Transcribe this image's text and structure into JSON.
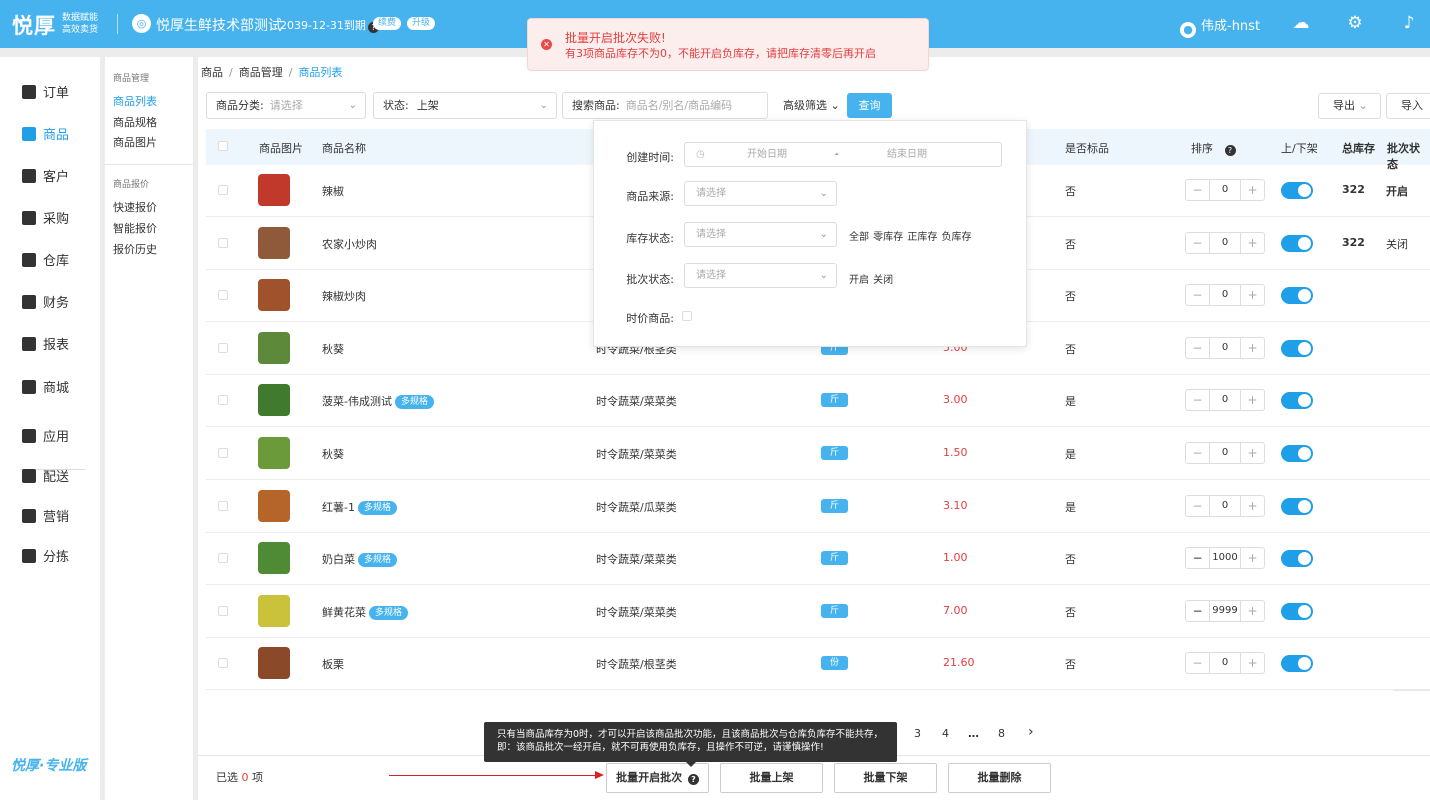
{
  "topbar": {
    "logo": "悦厚",
    "logo_sub1": "数据赋能",
    "logo_sub2": "高效卖货",
    "company": "悦厚生鲜技术部测试",
    "expiry": "2039-12-31到期",
    "renew": "续费",
    "upgrade": "升级",
    "user": "伟成-hnst",
    "icons": [
      "help-icon",
      "gear-icon",
      "bell-icon"
    ]
  },
  "toast": {
    "title": "批量开启批次失败!",
    "message": "有3项商品库存不为0，不能开启负库存，请把库存清零后再开启",
    "color": "#e23e3e"
  },
  "sidebar": {
    "items": [
      "订单",
      "商品",
      "客户",
      "采购",
      "仓库",
      "财务",
      "报表",
      "商城",
      "应用",
      "配送",
      "营销",
      "分拣"
    ],
    "active": "商品",
    "brand": "悦厚·专业版"
  },
  "subnav": {
    "group1": "商品管理",
    "group1_items": [
      "商品列表",
      "商品规格",
      "商品图片"
    ],
    "group2": "商品报价",
    "group2_items": [
      "快速报价",
      "智能报价",
      "报价历史"
    ]
  },
  "breadcrumb": [
    "商品",
    "商品管理",
    "商品列表"
  ],
  "filters": {
    "category_label": "商品分类:",
    "category_placeholder": "请选择",
    "status_label": "状态:",
    "status_value": "上架",
    "search_label": "搜索商品:",
    "search_placeholder": "商品名/别名/商品编码",
    "advanced": "高级筛选",
    "query": "查询",
    "export": "导出",
    "import": "导入"
  },
  "advanced_panel": {
    "created_label": "创建时间:",
    "start_placeholder": "开始日期",
    "dash": "-",
    "end_placeholder": "结束日期",
    "source_label": "商品来源:",
    "source_placeholder": "请选择",
    "stock_label": "库存状态:",
    "stock_placeholder": "请选择",
    "stock_options": "全部 零库存 正库存 负库存",
    "batch_label": "批次状态:",
    "batch_placeholder": "请选择",
    "batch_options": "开启 关闭",
    "seasonal_label": "时价商品:"
  },
  "table": {
    "headers": {
      "image": "商品图片",
      "name": "商品名称",
      "standard": "是否标品",
      "sort": "排序",
      "shelf": "上/下架",
      "stock": "总库存",
      "batch": "批次状态"
    },
    "rows": [
      {
        "name": "辣椒",
        "category": "",
        "unit": "",
        "price": "",
        "standard": "否",
        "sort": "0",
        "stock": "322",
        "batch": "开启",
        "multi": ""
      },
      {
        "name": "农家小炒肉",
        "category": "",
        "unit": "",
        "price": "",
        "standard": "否",
        "sort": "0",
        "stock": "322",
        "batch": "关闭",
        "multi": ""
      },
      {
        "name": "辣椒炒肉",
        "category": "",
        "unit": "",
        "price": "",
        "standard": "否",
        "sort": "0",
        "stock": "",
        "batch": "",
        "multi": ""
      },
      {
        "name": "秋葵",
        "category": "时令蔬菜/根茎类",
        "unit": "斤",
        "price": "5.00",
        "standard": "否",
        "sort": "0",
        "stock": "",
        "batch": "",
        "multi": ""
      },
      {
        "name": "菠菜-伟成测试",
        "category": "时令蔬菜/菜菜类",
        "unit": "斤",
        "price": "3.00",
        "standard": "是",
        "sort": "0",
        "stock": "",
        "batch": "",
        "multi": "多规格"
      },
      {
        "name": "秋葵",
        "category": "时令蔬菜/菜菜类",
        "unit": "斤",
        "price": "1.50",
        "standard": "是",
        "sort": "0",
        "stock": "",
        "batch": "",
        "multi": ""
      },
      {
        "name": "红薯-1",
        "category": "时令蔬菜/瓜菜类",
        "unit": "斤",
        "price": "3.10",
        "standard": "是",
        "sort": "0",
        "stock": "",
        "batch": "",
        "multi": "多规格"
      },
      {
        "name": "奶白菜",
        "category": "时令蔬菜/菜菜类",
        "unit": "斤",
        "price": "1.00",
        "standard": "否",
        "sort": "1000",
        "stock": "",
        "batch": "",
        "multi": "多规格"
      },
      {
        "name": "鲜黄花菜",
        "category": "时令蔬菜/菜菜类",
        "unit": "斤",
        "price": "7.00",
        "standard": "否",
        "sort": "9999",
        "stock": "",
        "batch": "",
        "multi": "多规格"
      },
      {
        "name": "板栗",
        "category": "时令蔬菜/根茎类",
        "unit": "份",
        "price": "21.60",
        "standard": "否",
        "sort": "0",
        "stock": "",
        "batch": "",
        "multi": ""
      }
    ]
  },
  "pagination": {
    "pages": [
      "3",
      "4",
      "…",
      "8"
    ],
    "next": "›"
  },
  "tooltip": {
    "line1": "只有当商品库存为0时，才可以开启该商品批次功能，且该商品批次与仓库负库存不能共存，",
    "line2": "即：该商品批次一经开启，就不可再使用负库存，且操作不可逆，请谨慎操作!"
  },
  "footer": {
    "selected_prefix": "已选",
    "selected_count": "0",
    "selected_suffix": "项",
    "btn_batch": "批量开启批次",
    "btn_up": "批量上架",
    "btn_down": "批量下架",
    "btn_delete": "批量删除"
  },
  "colors": {
    "accent": "#46b3ee",
    "link": "#1f9fe8",
    "danger": "#e23e3e"
  }
}
